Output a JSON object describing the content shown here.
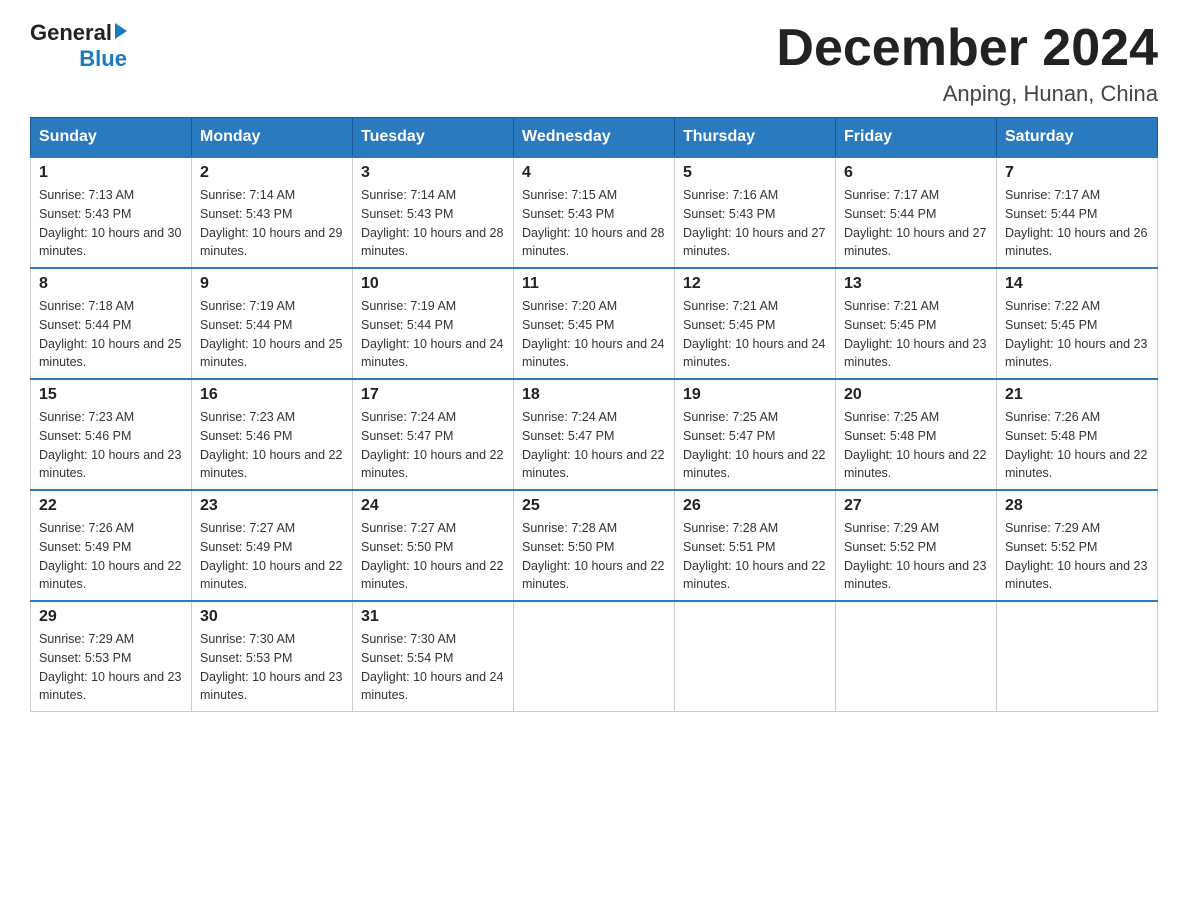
{
  "header": {
    "logo_general": "General",
    "logo_blue": "Blue",
    "title": "December 2024",
    "location": "Anping, Hunan, China"
  },
  "days_of_week": [
    "Sunday",
    "Monday",
    "Tuesday",
    "Wednesday",
    "Thursday",
    "Friday",
    "Saturday"
  ],
  "weeks": [
    [
      {
        "day": "1",
        "sunrise": "7:13 AM",
        "sunset": "5:43 PM",
        "daylight": "10 hours and 30 minutes."
      },
      {
        "day": "2",
        "sunrise": "7:14 AM",
        "sunset": "5:43 PM",
        "daylight": "10 hours and 29 minutes."
      },
      {
        "day": "3",
        "sunrise": "7:14 AM",
        "sunset": "5:43 PM",
        "daylight": "10 hours and 28 minutes."
      },
      {
        "day": "4",
        "sunrise": "7:15 AM",
        "sunset": "5:43 PM",
        "daylight": "10 hours and 28 minutes."
      },
      {
        "day": "5",
        "sunrise": "7:16 AM",
        "sunset": "5:43 PM",
        "daylight": "10 hours and 27 minutes."
      },
      {
        "day": "6",
        "sunrise": "7:17 AM",
        "sunset": "5:44 PM",
        "daylight": "10 hours and 27 minutes."
      },
      {
        "day": "7",
        "sunrise": "7:17 AM",
        "sunset": "5:44 PM",
        "daylight": "10 hours and 26 minutes."
      }
    ],
    [
      {
        "day": "8",
        "sunrise": "7:18 AM",
        "sunset": "5:44 PM",
        "daylight": "10 hours and 25 minutes."
      },
      {
        "day": "9",
        "sunrise": "7:19 AM",
        "sunset": "5:44 PM",
        "daylight": "10 hours and 25 minutes."
      },
      {
        "day": "10",
        "sunrise": "7:19 AM",
        "sunset": "5:44 PM",
        "daylight": "10 hours and 24 minutes."
      },
      {
        "day": "11",
        "sunrise": "7:20 AM",
        "sunset": "5:45 PM",
        "daylight": "10 hours and 24 minutes."
      },
      {
        "day": "12",
        "sunrise": "7:21 AM",
        "sunset": "5:45 PM",
        "daylight": "10 hours and 24 minutes."
      },
      {
        "day": "13",
        "sunrise": "7:21 AM",
        "sunset": "5:45 PM",
        "daylight": "10 hours and 23 minutes."
      },
      {
        "day": "14",
        "sunrise": "7:22 AM",
        "sunset": "5:45 PM",
        "daylight": "10 hours and 23 minutes."
      }
    ],
    [
      {
        "day": "15",
        "sunrise": "7:23 AM",
        "sunset": "5:46 PM",
        "daylight": "10 hours and 23 minutes."
      },
      {
        "day": "16",
        "sunrise": "7:23 AM",
        "sunset": "5:46 PM",
        "daylight": "10 hours and 22 minutes."
      },
      {
        "day": "17",
        "sunrise": "7:24 AM",
        "sunset": "5:47 PM",
        "daylight": "10 hours and 22 minutes."
      },
      {
        "day": "18",
        "sunrise": "7:24 AM",
        "sunset": "5:47 PM",
        "daylight": "10 hours and 22 minutes."
      },
      {
        "day": "19",
        "sunrise": "7:25 AM",
        "sunset": "5:47 PM",
        "daylight": "10 hours and 22 minutes."
      },
      {
        "day": "20",
        "sunrise": "7:25 AM",
        "sunset": "5:48 PM",
        "daylight": "10 hours and 22 minutes."
      },
      {
        "day": "21",
        "sunrise": "7:26 AM",
        "sunset": "5:48 PM",
        "daylight": "10 hours and 22 minutes."
      }
    ],
    [
      {
        "day": "22",
        "sunrise": "7:26 AM",
        "sunset": "5:49 PM",
        "daylight": "10 hours and 22 minutes."
      },
      {
        "day": "23",
        "sunrise": "7:27 AM",
        "sunset": "5:49 PM",
        "daylight": "10 hours and 22 minutes."
      },
      {
        "day": "24",
        "sunrise": "7:27 AM",
        "sunset": "5:50 PM",
        "daylight": "10 hours and 22 minutes."
      },
      {
        "day": "25",
        "sunrise": "7:28 AM",
        "sunset": "5:50 PM",
        "daylight": "10 hours and 22 minutes."
      },
      {
        "day": "26",
        "sunrise": "7:28 AM",
        "sunset": "5:51 PM",
        "daylight": "10 hours and 22 minutes."
      },
      {
        "day": "27",
        "sunrise": "7:29 AM",
        "sunset": "5:52 PM",
        "daylight": "10 hours and 23 minutes."
      },
      {
        "day": "28",
        "sunrise": "7:29 AM",
        "sunset": "5:52 PM",
        "daylight": "10 hours and 23 minutes."
      }
    ],
    [
      {
        "day": "29",
        "sunrise": "7:29 AM",
        "sunset": "5:53 PM",
        "daylight": "10 hours and 23 minutes."
      },
      {
        "day": "30",
        "sunrise": "7:30 AM",
        "sunset": "5:53 PM",
        "daylight": "10 hours and 23 minutes."
      },
      {
        "day": "31",
        "sunrise": "7:30 AM",
        "sunset": "5:54 PM",
        "daylight": "10 hours and 24 minutes."
      },
      null,
      null,
      null,
      null
    ]
  ]
}
